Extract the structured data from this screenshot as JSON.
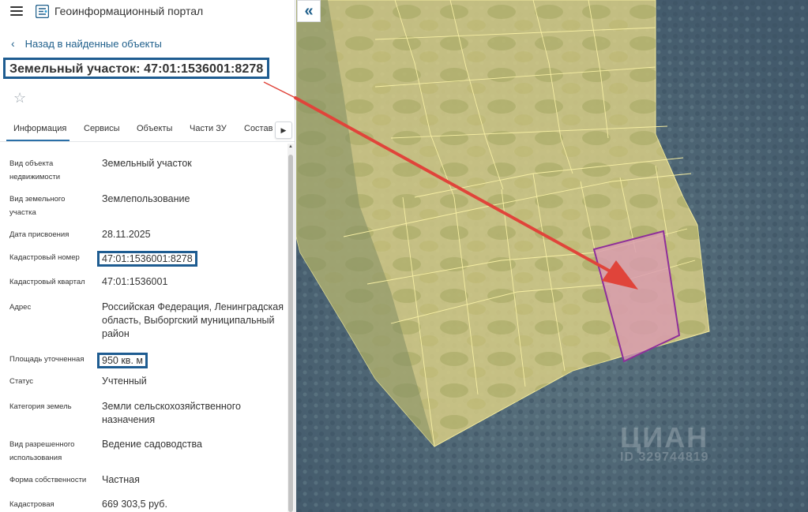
{
  "header": {
    "app_title": "Геоинформационный портал"
  },
  "nav": {
    "back_label": "Назад в найденные объекты"
  },
  "object": {
    "title": "Земельный участок: 47:01:1536001:8278"
  },
  "tabs": [
    {
      "label": "Информация"
    },
    {
      "label": "Сервисы"
    },
    {
      "label": "Объекты"
    },
    {
      "label": "Части ЗУ"
    },
    {
      "label": "Состав"
    }
  ],
  "properties": [
    {
      "label": "Вид объекта недвижимости",
      "value": "Земельный участок"
    },
    {
      "label": "Вид земельного участка",
      "value": "Землепользование"
    },
    {
      "label": "Дата присвоения",
      "value": "28.11.2025"
    },
    {
      "label": "Кадастровый номер",
      "value": "47:01:1536001:8278"
    },
    {
      "label": "Кадастровый квартал",
      "value": "47:01:1536001"
    },
    {
      "label": "Адрес",
      "value": "Российская Федерация, Ленинградская область, Выборгский муниципальный район"
    },
    {
      "label": "Площадь уточненная",
      "value": "950 кв. м"
    },
    {
      "label": "Статус",
      "value": "Учтенный"
    },
    {
      "label": "Категория земель",
      "value": "Земли сельскохозяйственного назначения"
    },
    {
      "label": "Вид разрешенного использования",
      "value": "Ведение садоводства"
    },
    {
      "label": "Форма собственности",
      "value": "Частная"
    },
    {
      "label": "Кадастровая",
      "value": "669 303,5 руб."
    }
  ],
  "map": {
    "watermark": "ЦИАН",
    "watermark_id": "ID 329744819"
  },
  "colors": {
    "accent": "#1f5f8b",
    "highlight_box": "#1e5c91",
    "parcel_fill": "#d99ab0",
    "parcel_stroke": "#8e2f9a",
    "arrow": "#e0443a",
    "quarter_fill": "#e8dc86"
  },
  "icons": [
    "menu-icon",
    "portal-logo-icon",
    "chevron-left-icon",
    "star-icon",
    "chevron-right-icon",
    "double-chevron-left-icon"
  ]
}
